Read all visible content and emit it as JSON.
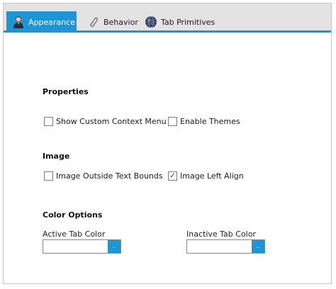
{
  "tabs": [
    {
      "label": "Appearance",
      "icon": "user-suit-icon",
      "active": true
    },
    {
      "label": "Behavior",
      "icon": "paperclip-icon",
      "active": false
    },
    {
      "label": "Tab Primitives",
      "icon": "globe-icon",
      "active": false
    }
  ],
  "sections": {
    "properties": {
      "title": "Properties",
      "show_custom_context_menu": {
        "label": "Show Custom Context Menu",
        "checked": false
      },
      "enable_themes": {
        "label": "Enable Themes",
        "checked": false
      }
    },
    "image": {
      "title": "Image",
      "image_outside_text_bounds": {
        "label": "Image Outside Text Bounds",
        "checked": false
      },
      "image_left_align": {
        "label": "Image Left Align",
        "checked": true
      }
    },
    "color_options": {
      "title": "Color Options",
      "active_tab_color": {
        "label": "Active Tab Color",
        "value": "",
        "button": ".."
      },
      "inactive_tab_color": {
        "label": "Inactive Tab Color",
        "value": "",
        "button": ".."
      }
    }
  },
  "colors": {
    "accent": "#1e95d6",
    "tabbar_bg": "#e3e3e3"
  },
  "check_glyph": "✓"
}
